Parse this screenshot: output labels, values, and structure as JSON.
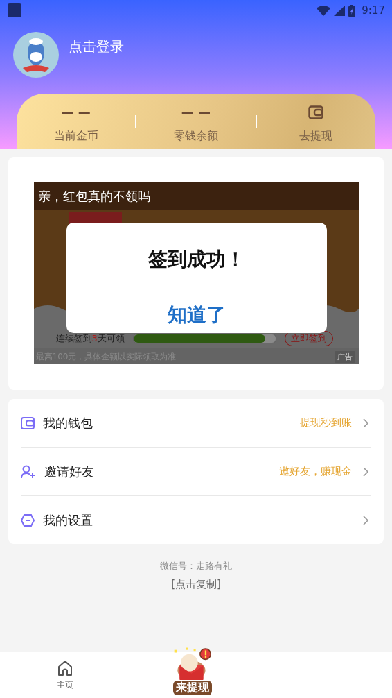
{
  "status_bar": {
    "time": "9:17"
  },
  "profile": {
    "login": "点击登录"
  },
  "stats": [
    {
      "kind": "value",
      "value": "— —",
      "label": "当前金币"
    },
    {
      "kind": "value",
      "value": "— —",
      "label": "零钱余额"
    },
    {
      "kind": "icon",
      "label": "去提现"
    }
  ],
  "ad": {
    "headline": "亲，红包真的不领吗",
    "progress_prefix": "连续签到",
    "progress_highlight": "3",
    "progress_suffix": "天可领",
    "level": 0.93,
    "button": "立即签到",
    "note": "最高100元，具体金额以实际领取为准",
    "badge": "广告"
  },
  "dialog": {
    "title": "签到成功！",
    "button": "知道了"
  },
  "menu": [
    {
      "kind": "wallet",
      "label": "我的钱包",
      "hint": "提现秒到账"
    },
    {
      "kind": "invite",
      "label": "邀请好友",
      "hint": "邀好友，赚现金"
    },
    {
      "kind": "settings",
      "label": "我的设置"
    }
  ],
  "footer": [
    "微信号：走路有礼",
    "[点击复制]"
  ],
  "tabs": [
    {
      "kind": "home",
      "label": "主页"
    },
    {
      "kind": "promo",
      "label": "来提现"
    }
  ]
}
